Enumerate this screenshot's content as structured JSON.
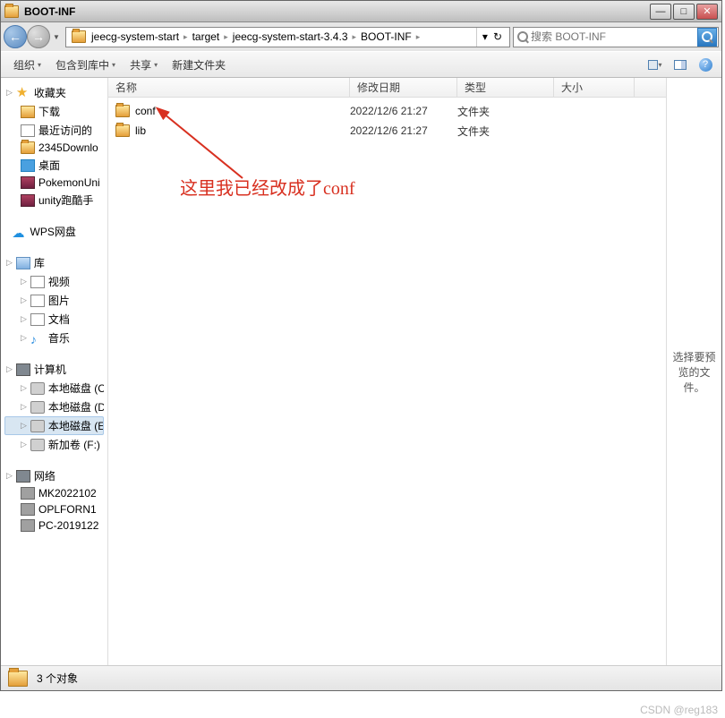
{
  "title": "BOOT-INF",
  "window_buttons": {
    "min": "—",
    "max": "□",
    "close": "✕"
  },
  "nav": {
    "back": "←",
    "fwd": "→",
    "drop": "▼"
  },
  "breadcrumb": [
    "jeecg-system-start",
    "target",
    "jeecg-system-start-3.4.3",
    "BOOT-INF"
  ],
  "bc_sep": "▸",
  "bc_drop": "▾",
  "refresh": "↻",
  "search": {
    "placeholder": "搜索 BOOT-INF"
  },
  "toolbar": {
    "org": "组织",
    "lib": "包含到库中",
    "share": "共享",
    "new": "新建文件夹",
    "view_drop": "▾",
    "help": "?"
  },
  "columns": {
    "name": "名称",
    "date": "修改日期",
    "type": "类型",
    "size": "大小"
  },
  "files": [
    {
      "name": "conf",
      "date": "2022/12/6 21:27",
      "type": "文件夹"
    },
    {
      "name": "lib",
      "date": "2022/12/6 21:27",
      "type": "文件夹"
    }
  ],
  "preview": "选择要预览的文件。",
  "status": "3 个对象",
  "sidebar": {
    "fav": {
      "head": "收藏夹",
      "items": [
        "下载",
        "最近访问的",
        "2345Downlo",
        "桌面",
        "PokemonUni",
        "unity跑酷手"
      ]
    },
    "wps": "WPS网盘",
    "lib": {
      "head": "库",
      "items": [
        "视频",
        "图片",
        "文档",
        "音乐"
      ]
    },
    "comp": {
      "head": "计算机",
      "items": [
        "本地磁盘 (C",
        "本地磁盘 (D",
        "本地磁盘 (E",
        "新加卷 (F:)"
      ]
    },
    "net": {
      "head": "网络",
      "items": [
        "MK2022102",
        "OPLFORN1",
        "PC-2019122"
      ]
    }
  },
  "annotation": "这里我已经改成了conf",
  "watermark": "CSDN @reg183"
}
